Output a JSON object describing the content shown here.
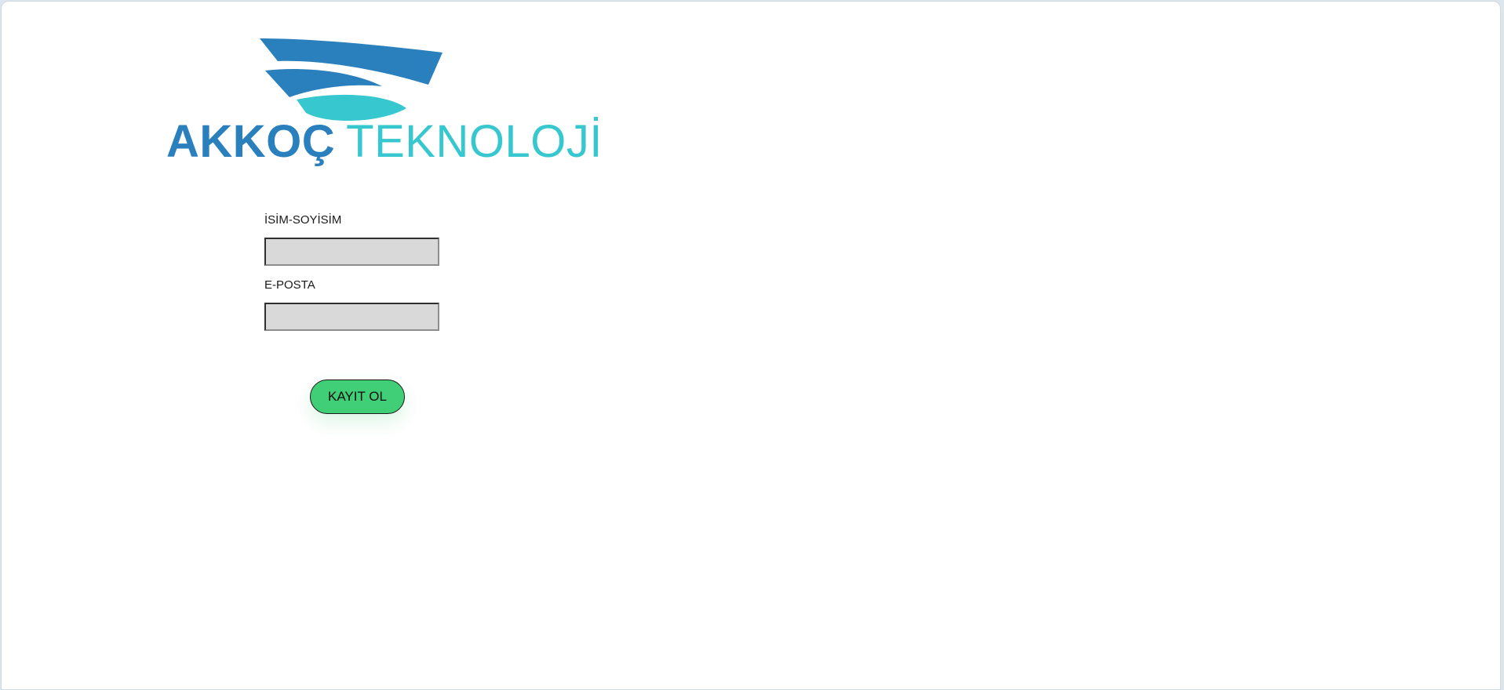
{
  "brand": {
    "logo_word_1": "AKKOÇ",
    "logo_word_2": "TEKNOLOJİ",
    "colors": {
      "primary_blue": "#2a7fbd",
      "accent_teal": "#36c7cf"
    }
  },
  "form": {
    "name_label": "İSİM-SOYİSİM",
    "name_value": "",
    "email_label": "E-POSTA",
    "email_value": "",
    "submit_label": "KAYIT OL",
    "submit_color": "#40cf76"
  }
}
